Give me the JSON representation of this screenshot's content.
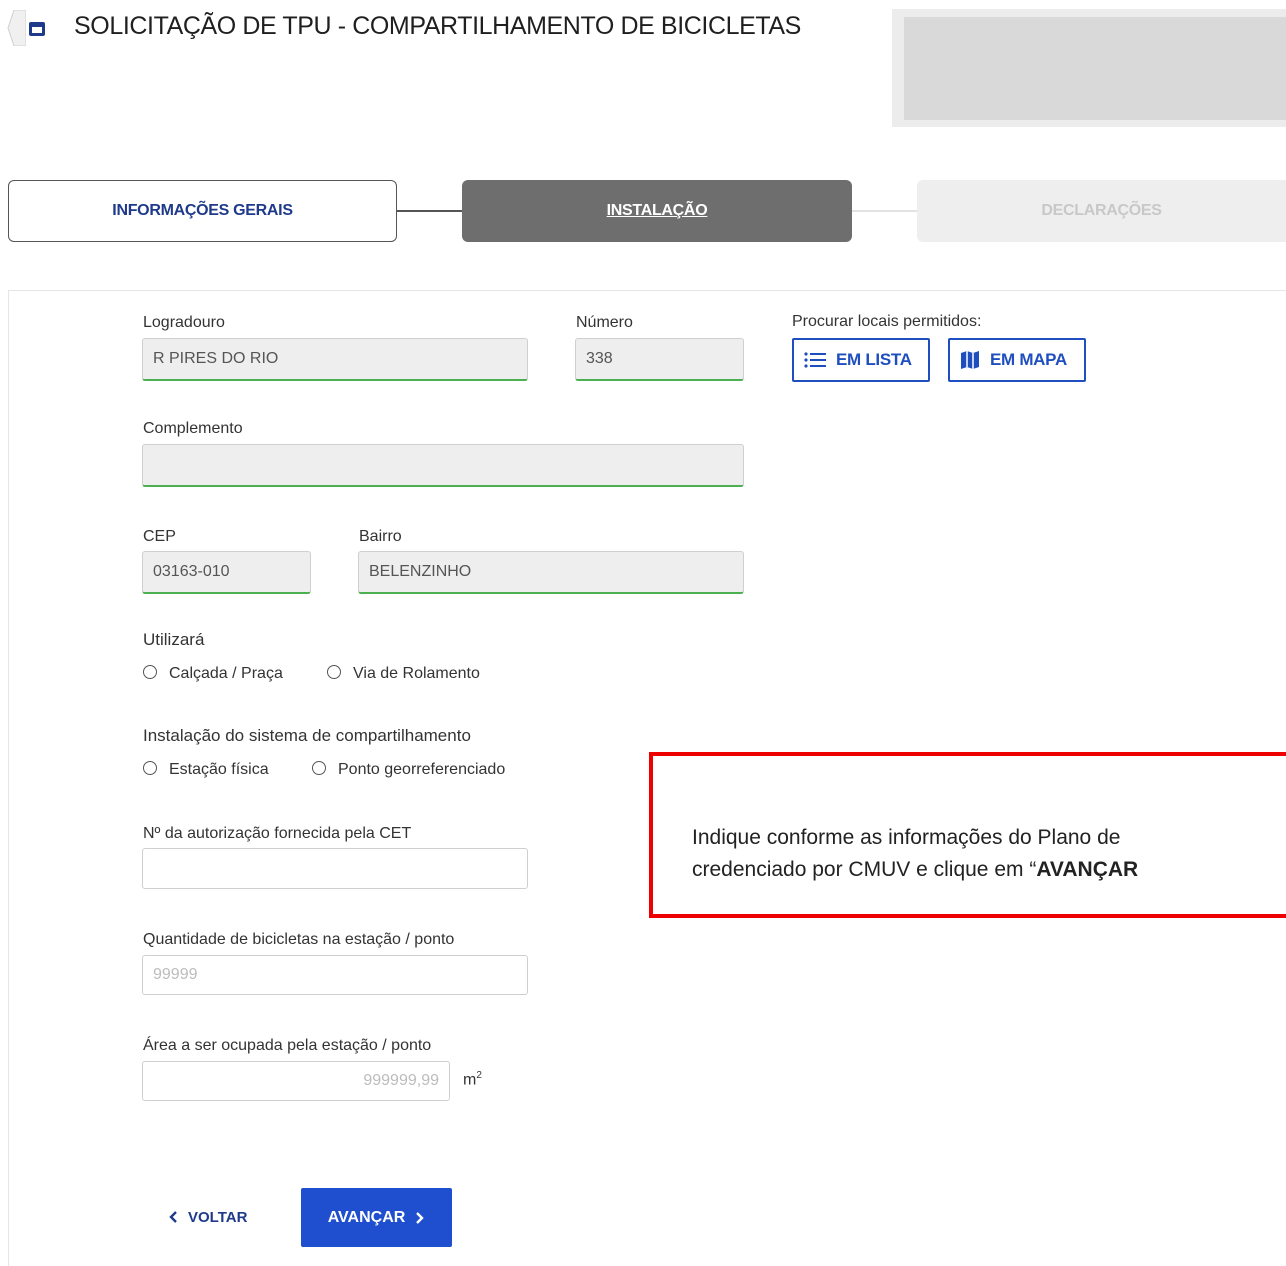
{
  "header": {
    "title": "SOLICITAÇÃO DE TPU - COMPARTILHAMENTO DE BICICLETAS"
  },
  "stepper": {
    "steps": [
      {
        "label": "INFORMAÇÕES GERAIS",
        "state": "done"
      },
      {
        "label": "INSTALAÇÃO",
        "state": "active"
      },
      {
        "label": "DECLARAÇÕES",
        "state": "disabled"
      }
    ]
  },
  "form": {
    "logradouro": {
      "label": "Logradouro",
      "value": "R PIRES DO RIO"
    },
    "numero": {
      "label": "Número",
      "value": "338"
    },
    "procurar": {
      "label": "Procurar locais permitidos:",
      "lista_label": "EM LISTA",
      "mapa_label": "EM MAPA"
    },
    "complemento": {
      "label": "Complemento",
      "value": ""
    },
    "cep": {
      "label": "CEP",
      "value": "03163-010"
    },
    "bairro": {
      "label": "Bairro",
      "value": "BELENZINHO"
    },
    "utilizara": {
      "label": "Utilizará",
      "options": [
        "Calçada / Praça",
        "Via de Rolamento"
      ]
    },
    "instalacao": {
      "label": "Instalação do sistema de compartilhamento",
      "options": [
        "Estação física",
        "Ponto georreferenciado"
      ]
    },
    "autorizacao": {
      "label": "Nº da autorização fornecida pela CET",
      "value": ""
    },
    "quantidade": {
      "label": "Quantidade de bicicletas na estação / ponto",
      "placeholder": "99999"
    },
    "area": {
      "label": "Área a ser ocupada pela estação / ponto",
      "placeholder": "999999,99",
      "unit": "m",
      "unit_exp": "2"
    }
  },
  "actions": {
    "back_label": "VOLTAR",
    "next_label": "AVANÇAR"
  },
  "callout": {
    "line1": "Indique conforme as informações do Plano de",
    "line2_prefix": "credenciado por CMUV e clique em “",
    "line2_bold": "AVANÇAR"
  },
  "colors": {
    "primary": "#1f4fcf",
    "valid_underline": "#4caf50",
    "callout_border": "#ee0000",
    "active_step": "#6e6e6e"
  }
}
